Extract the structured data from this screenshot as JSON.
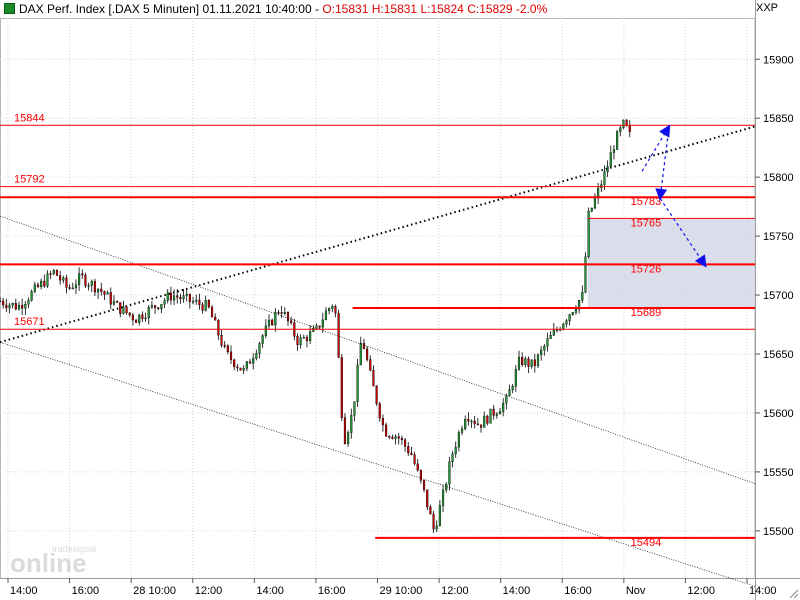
{
  "header": {
    "instrument": "DAX Perf. Index [.DAX  5 Minuten]",
    "datetime": "01.11.2021 10:40:00",
    "open": "O:15831",
    "high": "H:15831",
    "low": "L:15824",
    "close_change": "C:15829 -2.0%"
  },
  "axis_badge": "XXP",
  "watermark": {
    "word": "online",
    "brand": "tradesignal"
  },
  "colors": {
    "up": "#1e9a35",
    "down": "#cc0000",
    "level": "#ff0000",
    "arrow": "#1010ee",
    "zone": "#d3d8e6"
  },
  "chart_data": {
    "type": "candlestick",
    "timeframe": "5 Minuten",
    "ylim": [
      15460,
      15935
    ],
    "y_ticks": [
      15900,
      15850,
      15800,
      15750,
      15700,
      15650,
      15600,
      15550,
      15500
    ],
    "x_ticks": [
      "14:00",
      "16:00",
      "28  10:00",
      "12:00",
      "14:00",
      "16:00",
      "29  10:00",
      "12:00",
      "14:00",
      "16:00",
      "Nov",
      "12:00",
      "14:00"
    ],
    "grid": true,
    "levels": [
      {
        "value": 15844,
        "label": "15844",
        "side": "left"
      },
      {
        "value": 15792,
        "label": "15792",
        "side": "left"
      },
      {
        "value": 15783,
        "label": "15783",
        "side": "right"
      },
      {
        "value": 15765,
        "label": "15765",
        "side": "right"
      },
      {
        "value": 15726,
        "label": "15726",
        "side": "right"
      },
      {
        "value": 15689,
        "label": "15689",
        "side": "right"
      },
      {
        "value": 15671,
        "label": "15671",
        "side": "left"
      },
      {
        "value": 15494,
        "label": "15494",
        "side": "right"
      }
    ],
    "zone": {
      "from": 15689,
      "to": 15765
    },
    "close_path": [
      [
        0,
        15695
      ],
      [
        4,
        15690
      ],
      [
        8,
        15705
      ],
      [
        12,
        15720
      ],
      [
        15,
        15705
      ],
      [
        18,
        15715
      ],
      [
        22,
        15705
      ],
      [
        26,
        15690
      ],
      [
        30,
        15680
      ],
      [
        34,
        15690
      ],
      [
        38,
        15700
      ],
      [
        42,
        15695
      ],
      [
        46,
        15690
      ],
      [
        50,
        15650
      ],
      [
        54,
        15635
      ],
      [
        58,
        15665
      ],
      [
        62,
        15690
      ],
      [
        66,
        15660
      ],
      [
        70,
        15670
      ],
      [
        72,
        15685
      ],
      [
        74,
        15695
      ],
      [
        75,
        15640
      ],
      [
        76,
        15575
      ],
      [
        78,
        15600
      ],
      [
        80,
        15665
      ],
      [
        82,
        15630
      ],
      [
        85,
        15585
      ],
      [
        88,
        15580
      ],
      [
        91,
        15565
      ],
      [
        94,
        15530
      ],
      [
        96,
        15500
      ],
      [
        98,
        15530
      ],
      [
        100,
        15565
      ],
      [
        103,
        15600
      ],
      [
        106,
        15590
      ],
      [
        109,
        15600
      ],
      [
        112,
        15610
      ],
      [
        115,
        15645
      ],
      [
        118,
        15640
      ],
      [
        121,
        15660
      ],
      [
        124,
        15675
      ],
      [
        127,
        15690
      ],
      [
        129,
        15700
      ],
      [
        130,
        15765
      ],
      [
        132,
        15785
      ],
      [
        134,
        15805
      ],
      [
        136,
        15830
      ],
      [
        138,
        15845
      ],
      [
        140,
        15830
      ]
    ],
    "trendlines": [
      {
        "style": "dotted",
        "from": [
          0,
          15660
        ],
        "to": [
          167,
          15843
        ]
      },
      {
        "style": "thin",
        "from": [
          0,
          15767
        ],
        "to": [
          167,
          15540
        ]
      },
      {
        "style": "thin",
        "from": [
          0,
          15660
        ],
        "to": [
          167,
          15453
        ]
      }
    ],
    "projection": [
      [
        142,
        15805
      ],
      [
        148,
        15843
      ],
      [
        146,
        15782
      ],
      [
        156,
        15725
      ]
    ]
  }
}
